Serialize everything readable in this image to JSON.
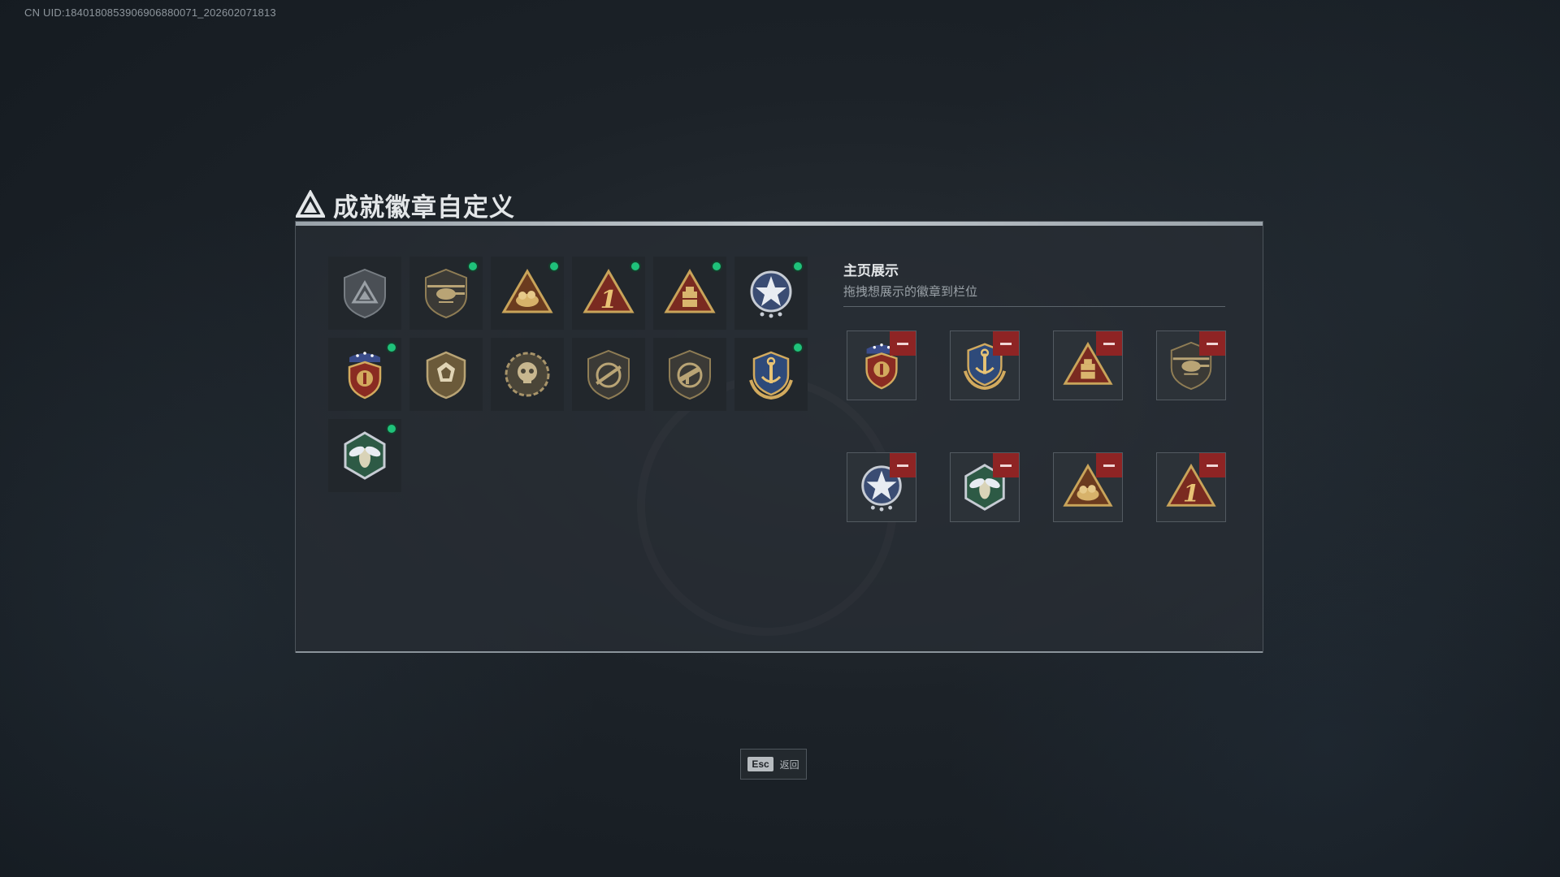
{
  "uid_text": "CN UID:1840180853906906880071_202602071813",
  "title": "成就徽章自定义",
  "badges": [
    {
      "icon": "gray-triangle-shield-badge-icon",
      "new": false
    },
    {
      "icon": "helicopter-shield-badge-icon",
      "new": true
    },
    {
      "icon": "gold-triangle-bundle-badge-icon",
      "new": true
    },
    {
      "icon": "red-triangle-number-one-badge-icon",
      "new": true
    },
    {
      "icon": "gold-triangle-crate-badge-icon",
      "new": true
    },
    {
      "icon": "blue-star-crest-badge-icon",
      "new": true
    },
    {
      "icon": "winged-eagle-stars-badge-icon",
      "new": true
    },
    {
      "icon": "bronze-crest-shield-badge-icon",
      "new": false
    },
    {
      "icon": "skull-gear-badge-icon",
      "new": false
    },
    {
      "icon": "crossed-rifle-shield-badge-icon",
      "new": false
    },
    {
      "icon": "smg-shield-badge-icon",
      "new": false
    },
    {
      "icon": "anchor-wreath-shield-badge-icon",
      "new": true
    },
    {
      "icon": "green-hexagon-hornet-badge-icon",
      "new": true
    }
  ],
  "showcase": {
    "title": "主页展示",
    "subtitle": "拖拽想展示的徽章到栏位",
    "slots": [
      {
        "icon": "winged-eagle-stars-badge-icon"
      },
      {
        "icon": "anchor-wreath-shield-badge-icon"
      },
      {
        "icon": "gold-triangle-crate-badge-icon"
      },
      {
        "icon": "helicopter-shield-badge-icon"
      },
      {
        "icon": "blue-star-crest-badge-icon"
      },
      {
        "icon": "green-hexagon-hornet-badge-icon"
      },
      {
        "icon": "gold-triangle-bundle-badge-icon"
      },
      {
        "icon": "red-triangle-number-one-badge-icon"
      }
    ]
  },
  "esc": {
    "key": "Esc",
    "label": "返回"
  },
  "colors": {
    "accent_green": "#1fc27a",
    "remove_red": "#8e2424",
    "gold": "#c9a45a"
  }
}
